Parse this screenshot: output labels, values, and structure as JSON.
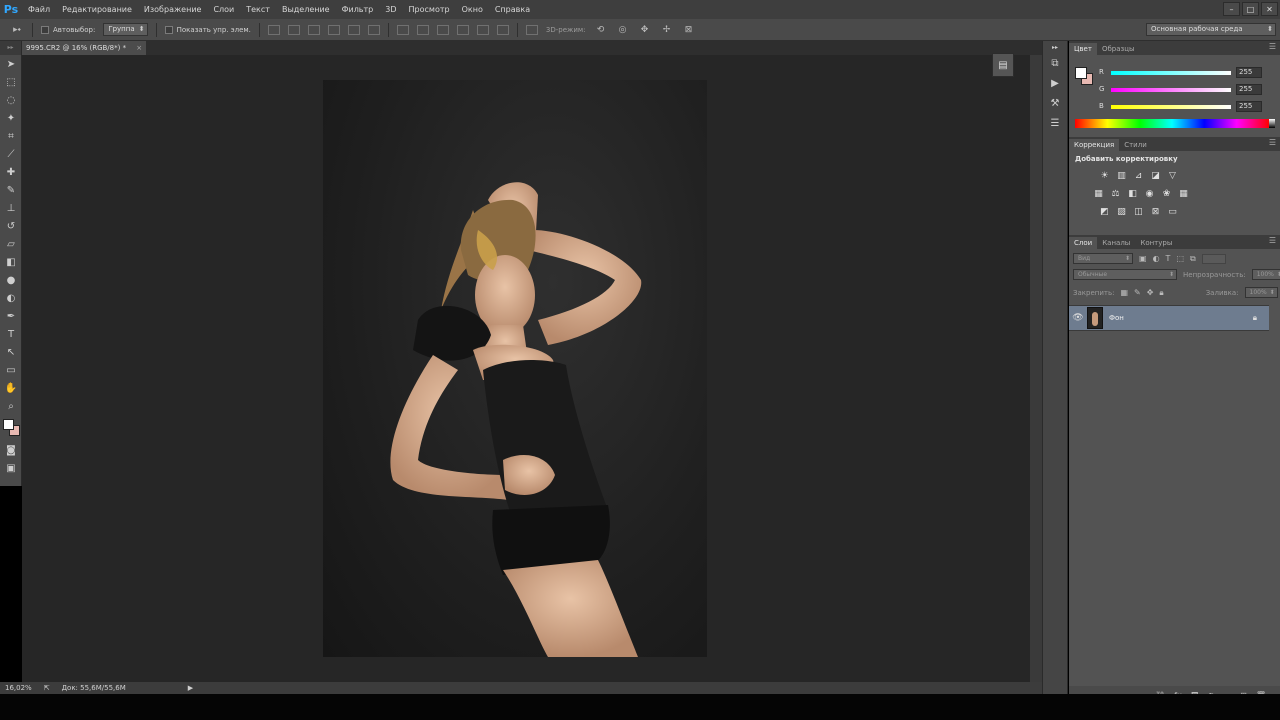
{
  "app": {
    "logo": "Ps"
  },
  "menu": [
    "Файл",
    "Редактирование",
    "Изображение",
    "Слои",
    "Текст",
    "Выделение",
    "Фильтр",
    "3D",
    "Просмотр",
    "Окно",
    "Справка"
  ],
  "window_controls": [
    "–",
    "□",
    "✕"
  ],
  "options_bar": {
    "auto_select_label": "Автовыбор:",
    "auto_select_value": "Группа",
    "show_controls_label": "Показать упр. элем.",
    "mode_3d_label": "3D-режим:",
    "workspace": "Основная рабочая среда"
  },
  "document": {
    "tab_title": "9995.CR2 @ 16% (RGB/8*) *",
    "close": "×"
  },
  "status": {
    "zoom": "16,02%",
    "doc_info": "Док: 55,6M/55,6M"
  },
  "color_panel": {
    "tabs": [
      "Цвет",
      "Образцы"
    ],
    "channels": [
      {
        "label": "R",
        "value": "255",
        "color": "#2ec4d4"
      },
      {
        "label": "G",
        "value": "255",
        "color": "#d44fd4"
      },
      {
        "label": "B",
        "value": "255",
        "color": "#d4d42a"
      }
    ],
    "foreground": "#ffffff",
    "background": "#e8b9b2"
  },
  "adjustments_panel": {
    "tabs": [
      "Коррекция",
      "Стили"
    ],
    "title": "Добавить корректировку"
  },
  "layers_panel": {
    "tabs": [
      "Слои",
      "Каналы",
      "Контуры"
    ],
    "filter_kind": "Вид",
    "blend_mode": "Обычные",
    "opacity_label": "Непрозрачность:",
    "opacity_value": "100%",
    "lock_label": "Закрепить:",
    "fill_label": "Заливка:",
    "fill_value": "100%",
    "layers": [
      {
        "name": "Фон",
        "visible": true,
        "locked": true
      }
    ]
  },
  "colors": {
    "menubar": "#3e3e3e",
    "canvas_bg": "#262626",
    "panel_bg": "#535353",
    "selected_layer": "#6e7c8f"
  }
}
